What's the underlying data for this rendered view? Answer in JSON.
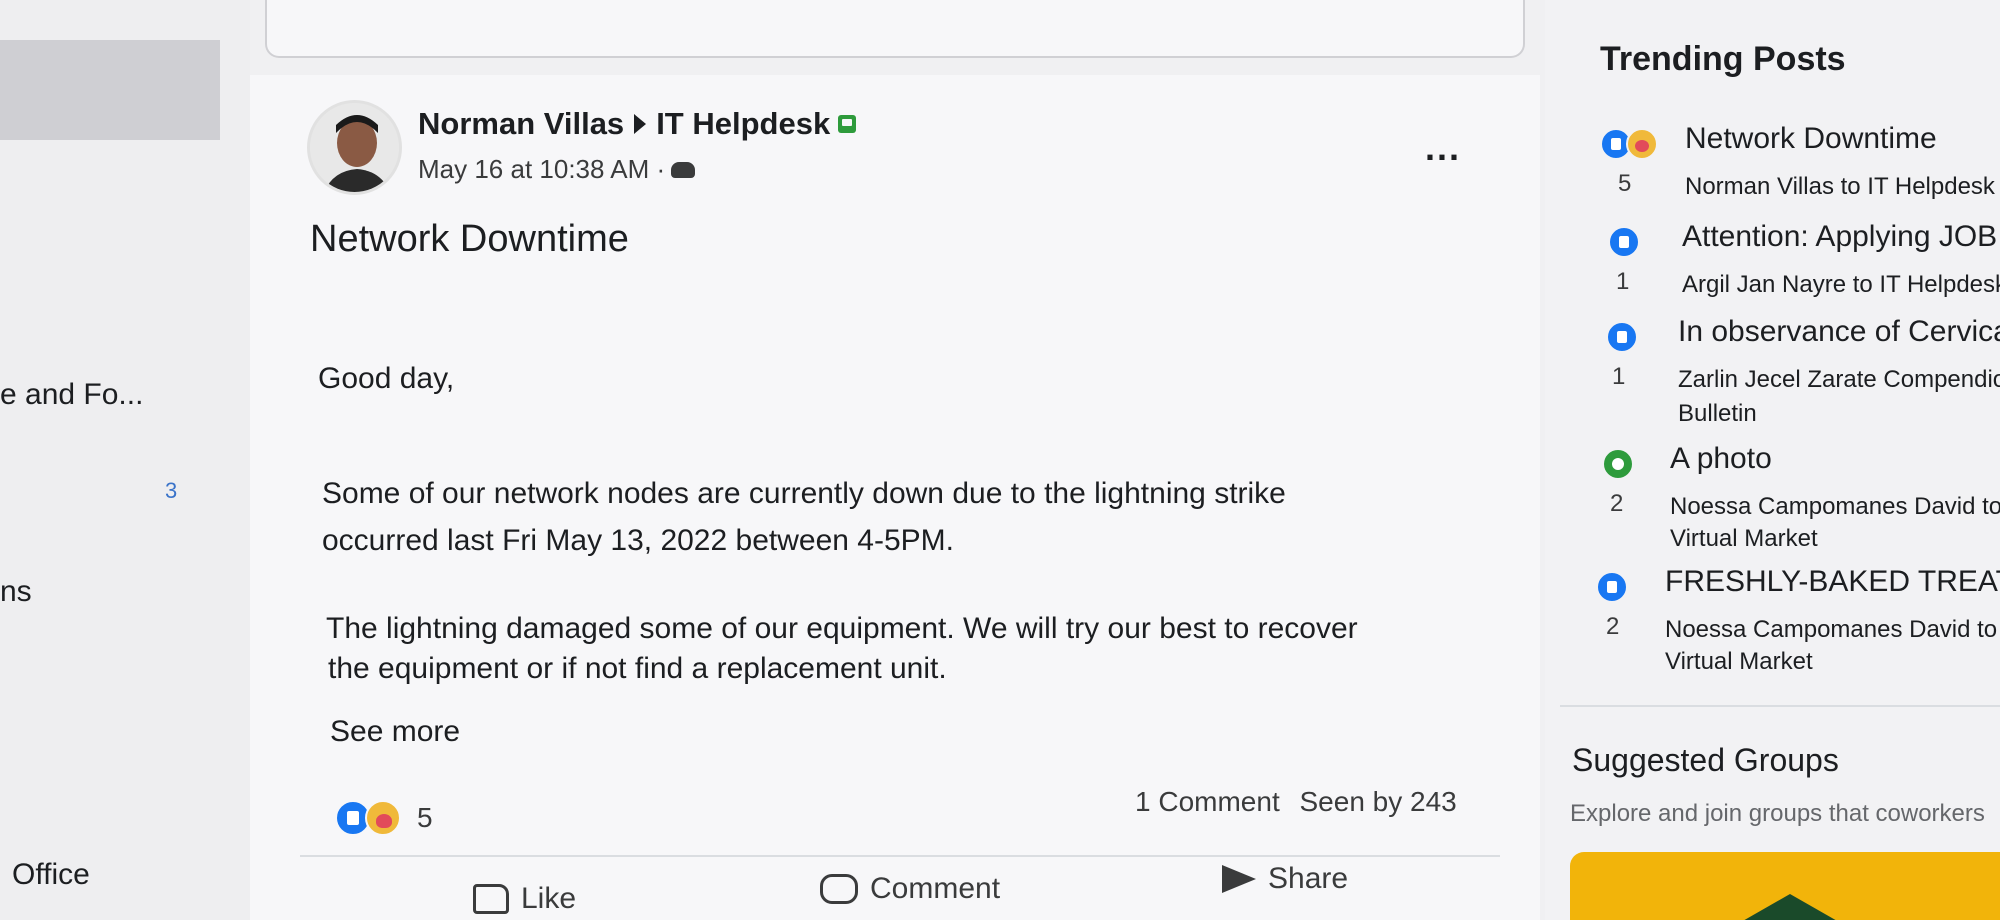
{
  "sidebar": {
    "items": [
      {
        "label": "e and Fo..."
      },
      {
        "label": "ns"
      },
      {
        "label": "Office"
      }
    ],
    "badge_count": "3"
  },
  "post": {
    "author": "Norman Villas",
    "group": "IT Helpdesk",
    "timestamp": "May 16 at 10:38 AM ·",
    "more_label": "...",
    "title": "Network Downtime",
    "greeting": "Good day,",
    "body_lines": [
      "Some of our network nodes are currently down due to the lightning strike",
      "occurred last Fri May 13, 2022 between 4-5PM.",
      "The lightning damaged some of our equipment. We will try our best to recover",
      "the equipment or if not find a replacement unit."
    ],
    "see_more": "See more",
    "reaction_count": "5",
    "comments": "1 Comment",
    "seen_by": "Seen by 243",
    "actions": {
      "like": "Like",
      "comment": "Comment",
      "share": "Share"
    }
  },
  "trending": {
    "header": "Trending Posts",
    "items": [
      {
        "title": "Network Downtime",
        "count": "5",
        "sub": "Norman Villas to IT Helpdesk",
        "sub2": ""
      },
      {
        "title": "Attention: Applying JOB",
        "count": "1",
        "sub": "Argil Jan Nayre to IT Helpdesk",
        "sub2": ""
      },
      {
        "title": "In observance of Cervical",
        "count": "1",
        "sub": "Zarlin Jecel Zarate Compendio to",
        "sub2": "Bulletin"
      },
      {
        "title": "A photo",
        "count": "2",
        "sub": "Noessa Campomanes David to V",
        "sub2": "Virtual Market"
      },
      {
        "title": "FRESHLY-BAKED TREATS !",
        "count": "2",
        "sub": "Noessa Campomanes David to VS",
        "sub2": "Virtual Market"
      }
    ]
  },
  "suggested": {
    "header": "Suggested Groups",
    "subtitle": "Explore and join groups that coworkers"
  },
  "colors": {
    "like_blue": "#1877f2",
    "badge_green": "#2e9b3c",
    "promo_yellow": "#f2b40a"
  }
}
